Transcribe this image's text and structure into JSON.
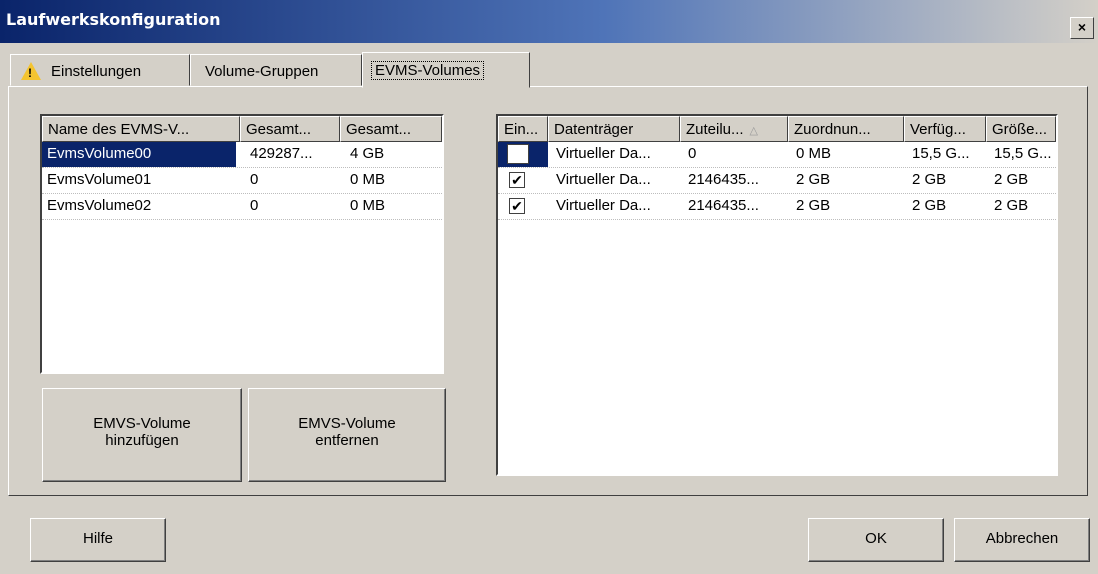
{
  "window": {
    "title": "Laufwerkskonfiguration",
    "close_glyph": "×"
  },
  "tabs": [
    {
      "label": "Einstellungen",
      "icon": "warning-icon",
      "active": false
    },
    {
      "label": "Volume-Gruppen",
      "active": false
    },
    {
      "label": "EVMS-Volumes",
      "active": true
    }
  ],
  "left_list": {
    "headers": [
      "Name des EVMS-V...",
      "Gesamt...",
      "Gesamt..."
    ],
    "rows": [
      [
        "EvmsVolume00",
        "429287...",
        "4 GB"
      ],
      [
        "EvmsVolume01",
        "0",
        "0 MB"
      ],
      [
        "EvmsVolume02",
        "0",
        "0 MB"
      ]
    ],
    "selected_row": 0
  },
  "right_list": {
    "headers": [
      "Ein...",
      "Datenträger",
      "Zuteilu...",
      "Zuordnun...",
      "Verfüg...",
      "Größe..."
    ],
    "sort_indicator": "△",
    "rows": [
      {
        "checked": false,
        "cells": [
          "Virtueller Da...",
          "0",
          "0 MB",
          "15,5 G...",
          "15,5 G..."
        ]
      },
      {
        "checked": true,
        "cells": [
          "Virtueller Da...",
          "2146435...",
          "2 GB",
          "2 GB",
          "2 GB"
        ]
      },
      {
        "checked": true,
        "cells": [
          "Virtueller Da...",
          "2146435...",
          "2 GB",
          "2 GB",
          "2 GB"
        ]
      }
    ]
  },
  "buttons": {
    "add_volume_line1": "EMVS-Volume",
    "add_volume_line2": "hinzufügen",
    "remove_volume_line1": "EMVS-Volume",
    "remove_volume_line2": "entfernen",
    "help": "Hilfe",
    "ok": "OK",
    "cancel": "Abbrechen"
  },
  "colors": {
    "selection": "#0a246a",
    "face": "#d4d0c8",
    "warning": "#f4c430"
  }
}
